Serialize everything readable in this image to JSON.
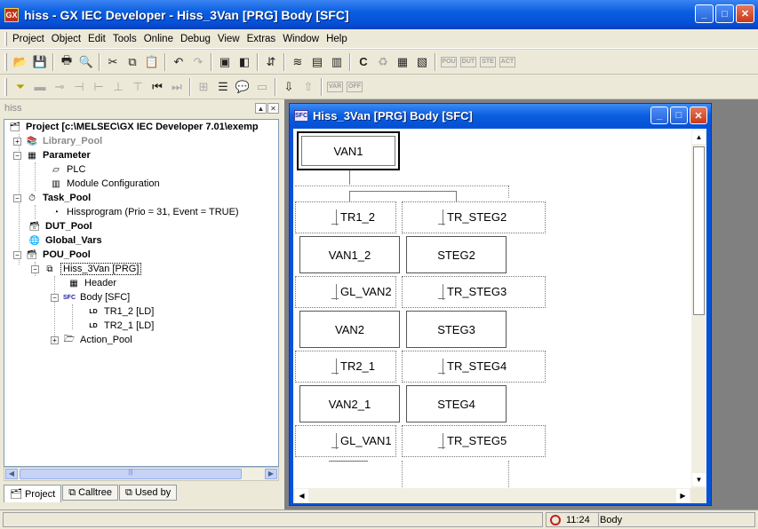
{
  "app": {
    "title": "hiss - GX IEC Developer - Hiss_3Van [PRG] Body [SFC]",
    "window_buttons": [
      "_",
      "□",
      "✕"
    ]
  },
  "menu": [
    "Project",
    "Object",
    "Edit",
    "Tools",
    "Online",
    "Debug",
    "View",
    "Extras",
    "Window",
    "Help"
  ],
  "toolbar1": {
    "icons": [
      "open-icon",
      "save-icon",
      "print-icon",
      "print-preview-icon",
      "cut-icon",
      "copy-icon",
      "paste-icon",
      "undo-icon",
      "redo-icon",
      "properties-icon",
      "object-icon",
      "update-icon",
      "compile-icon",
      "build-icon",
      "rebuild-icon",
      "online-icon",
      "transfer-icon",
      "monitor-icon",
      "monitor2-icon"
    ],
    "small_labels": [
      "POU",
      "DUT",
      "STE",
      "ACT"
    ]
  },
  "toolbar2": {
    "small_labels": [
      "VAR",
      "OFF"
    ]
  },
  "project_panel": {
    "header": "hiss",
    "root": "Project [c:\\MELSEC\\GX IEC Developer 7.01\\exemp",
    "items": [
      {
        "label": "Library_Pool"
      },
      {
        "label": "Parameter"
      },
      {
        "label": "PLC"
      },
      {
        "label": "Module Configuration"
      },
      {
        "label": "Task_Pool"
      },
      {
        "label": "Hissprogram (Prio = 31, Event = TRUE)"
      },
      {
        "label": "DUT_Pool"
      },
      {
        "label": "Global_Vars"
      },
      {
        "label": "POU_Pool"
      },
      {
        "label": "Hiss_3Van [PRG]"
      },
      {
        "label": "Header"
      },
      {
        "label": "Body [SFC]"
      },
      {
        "label": "TR1_2 [LD]"
      },
      {
        "label": "TR2_1 [LD]"
      },
      {
        "label": "Action_Pool"
      }
    ],
    "tabs": [
      "Project",
      "Calltree",
      "Used by"
    ]
  },
  "sfc_window": {
    "title": "Hiss_3Van [PRG] Body [SFC]",
    "steps": [
      "VAN1",
      "VAN1_2",
      "STEG2",
      "VAN2",
      "STEG3",
      "VAN2_1",
      "STEG4"
    ],
    "transitions": [
      "TR1_2",
      "TR_STEG2",
      "GL_VAN2",
      "TR_STEG3",
      "TR2_1",
      "TR_STEG4",
      "GL_VAN1",
      "TR_STEG5"
    ]
  },
  "statusbar": {
    "time": "11:24",
    "context": "Body"
  }
}
